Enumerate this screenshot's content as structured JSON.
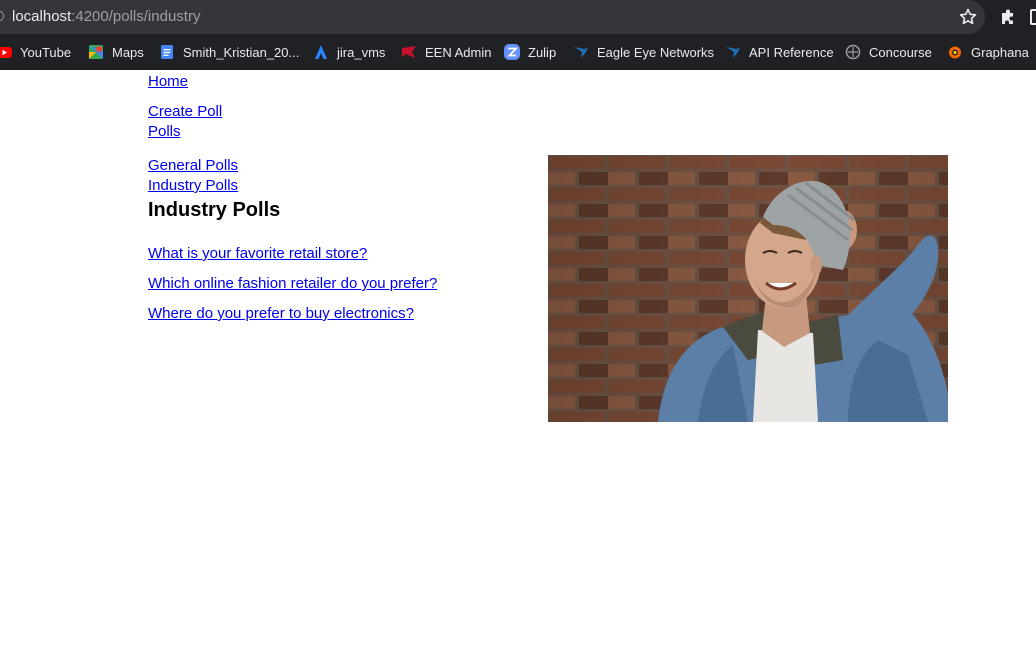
{
  "browser": {
    "url_host": "localhost",
    "url_path": ":4200/polls/industry",
    "bookmarks": [
      {
        "label": "YouTube",
        "icon": "youtube-icon"
      },
      {
        "label": "Maps",
        "icon": "maps-icon"
      },
      {
        "label": "Smith_Kristian_20...",
        "icon": "docs-icon"
      },
      {
        "label": "jira_vms",
        "icon": "jira-icon"
      },
      {
        "label": "EEN Admin",
        "icon": "een-icon"
      },
      {
        "label": "Zulip",
        "icon": "zulip-icon"
      },
      {
        "label": "Eagle Eye Networks",
        "icon": "eagle-eye-icon"
      },
      {
        "label": "API Reference",
        "icon": "eagle-eye-icon"
      },
      {
        "label": "Concourse",
        "icon": "concourse-icon"
      },
      {
        "label": "Graphana",
        "icon": "grafana-icon"
      }
    ]
  },
  "nav": {
    "home": "Home",
    "create_poll": "Create Poll",
    "polls": "Polls",
    "general_polls": "General Polls",
    "industry_polls": "Industry Polls"
  },
  "main": {
    "title": "Industry Polls",
    "polls": [
      "What is your favorite retail store?",
      "Which online fashion retailer do you prefer?",
      "Where do you prefer to buy electronics?"
    ]
  },
  "colors": {
    "link": "#0000ee",
    "chrome_bg": "#202124",
    "urlbar_bg": "#35363a"
  }
}
